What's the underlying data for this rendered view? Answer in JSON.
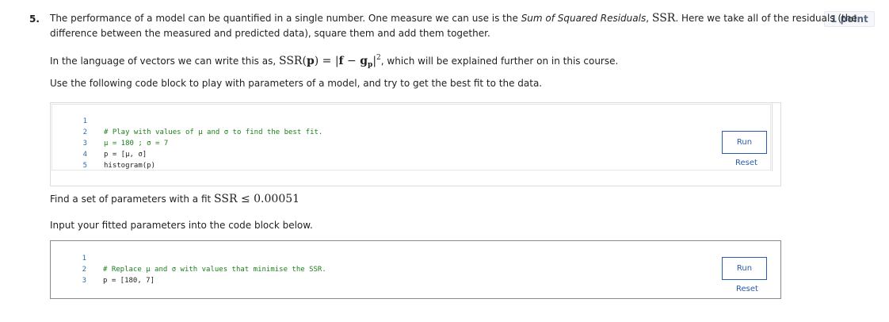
{
  "question": {
    "number": "5.",
    "points_badge": "1 point",
    "para1_line1_a": "The performance of a model can be quantified in a single number. One measure we can use is the ",
    "para1_line1_italic": "Sum of Squared Residuals",
    "para1_line1_b": ", ",
    "para1_line1_math": "SSR",
    "para1_line1_c": ". Here we take all of the residuals (the",
    "para1_line2": "difference between the measured and predicted data), square them and add them together.",
    "para2_a": "In the language of vectors we can write this as, ",
    "para2_math_ssr": "SSR",
    "para2_math_open": "(",
    "para2_math_p": "p",
    "para2_math_eq": ") = |",
    "para2_math_f": "f",
    "para2_math_minus": " − ",
    "para2_math_g": "g",
    "para2_math_gsub": "p",
    "para2_math_close": "|",
    "para2_math_sup": "2",
    "para2_b": ", which will be explained further on in this course.",
    "para3": "Use the following code block to play with parameters of a model, and try to get the best fit to the data.",
    "para4_a": "Find a set of parameters with a fit ",
    "para4_math": "SSR ≤ 0.00051",
    "para5": "Input your fitted parameters into the code block below."
  },
  "code_block_1": {
    "lines": [
      {
        "n": "1",
        "text": "# Play with values of μ and σ to find the best fit."
      },
      {
        "n": "2",
        "text": "μ = 180 ; σ = 7"
      },
      {
        "n": "3",
        "text": "p = [μ, σ]"
      },
      {
        "n": "4",
        "text": "histogram(p)"
      },
      {
        "n": "5",
        "text": ""
      }
    ],
    "run_label": "Run",
    "reset_label": "Reset"
  },
  "code_block_2": {
    "lines": [
      {
        "n": "1",
        "text": "# Replace μ and σ with values that minimise the SSR."
      },
      {
        "n": "2",
        "text": "p = [180, 7]"
      },
      {
        "n": "3",
        "text": ""
      }
    ],
    "run_label": "Run",
    "reset_label": "Reset"
  }
}
